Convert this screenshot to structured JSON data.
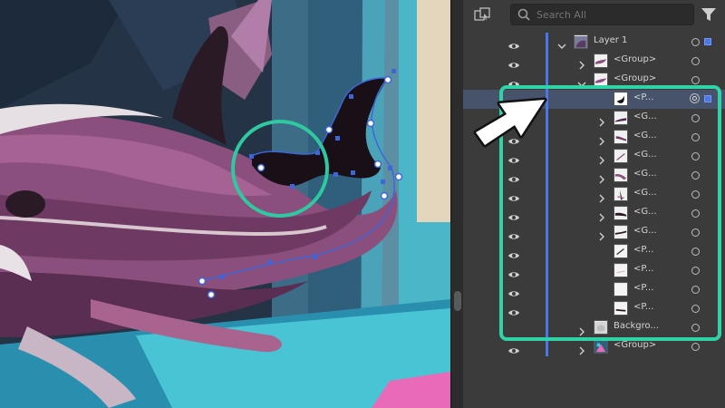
{
  "search": {
    "placeholder": "Search All"
  },
  "layers": {
    "rows": [
      {
        "label": "Layer 1",
        "selected": false
      },
      {
        "label": "<Group>",
        "selected": false
      },
      {
        "label": "<Group>",
        "selected": false
      },
      {
        "label": "<P...",
        "selected": true
      },
      {
        "label": "<G...",
        "selected": false
      },
      {
        "label": "<G...",
        "selected": false
      },
      {
        "label": "<G...",
        "selected": false
      },
      {
        "label": "<G...",
        "selected": false
      },
      {
        "label": "<G...",
        "selected": false
      },
      {
        "label": "<G...",
        "selected": false
      },
      {
        "label": "<G...",
        "selected": false
      },
      {
        "label": "<P...",
        "selected": false
      },
      {
        "label": "<P...",
        "selected": false
      },
      {
        "label": "<P...",
        "selected": false
      },
      {
        "label": "<P...",
        "selected": false
      },
      {
        "label": "Backgro...",
        "selected": false
      },
      {
        "label": "<Group>",
        "selected": false
      }
    ]
  },
  "colors": {
    "selection_accent": "#4a78e6",
    "highlight_box": "#2fd3a6",
    "selected_row": "#47536a",
    "panel_bg": "#3b3b3b"
  },
  "icons": {
    "locate": "locate-object-icon",
    "search": "search-icon",
    "filter": "filter-icon",
    "visibility": "eye-icon",
    "expand": "chevron-right-icon",
    "collapse": "chevron-down-icon",
    "target": "target-circle-icon",
    "pointer": "arrow-pointer-icon"
  }
}
